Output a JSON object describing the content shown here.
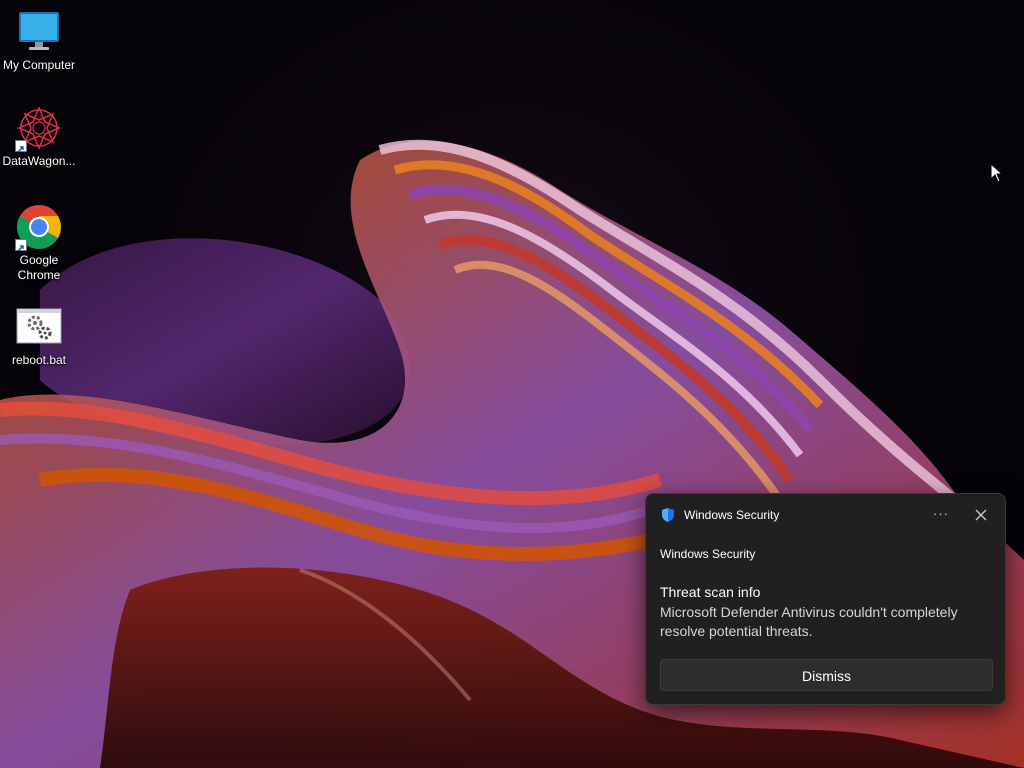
{
  "desktop": {
    "icons": [
      {
        "label": "My Computer",
        "icon": "monitor-icon"
      },
      {
        "label": "DataWagon...",
        "icon": "datawagon-icon"
      },
      {
        "label": "Google Chrome",
        "icon": "chrome-icon"
      },
      {
        "label": "reboot.bat",
        "icon": "batch-file-icon"
      }
    ]
  },
  "toast": {
    "app_name": "Windows Security",
    "more_glyph": "···",
    "source": "Windows Security",
    "title": "Threat scan info",
    "body": "Microsoft Defender Antivirus couldn't completely resolve potential threats.",
    "dismiss_label": "Dismiss",
    "accent_color": "#1a73e8"
  }
}
